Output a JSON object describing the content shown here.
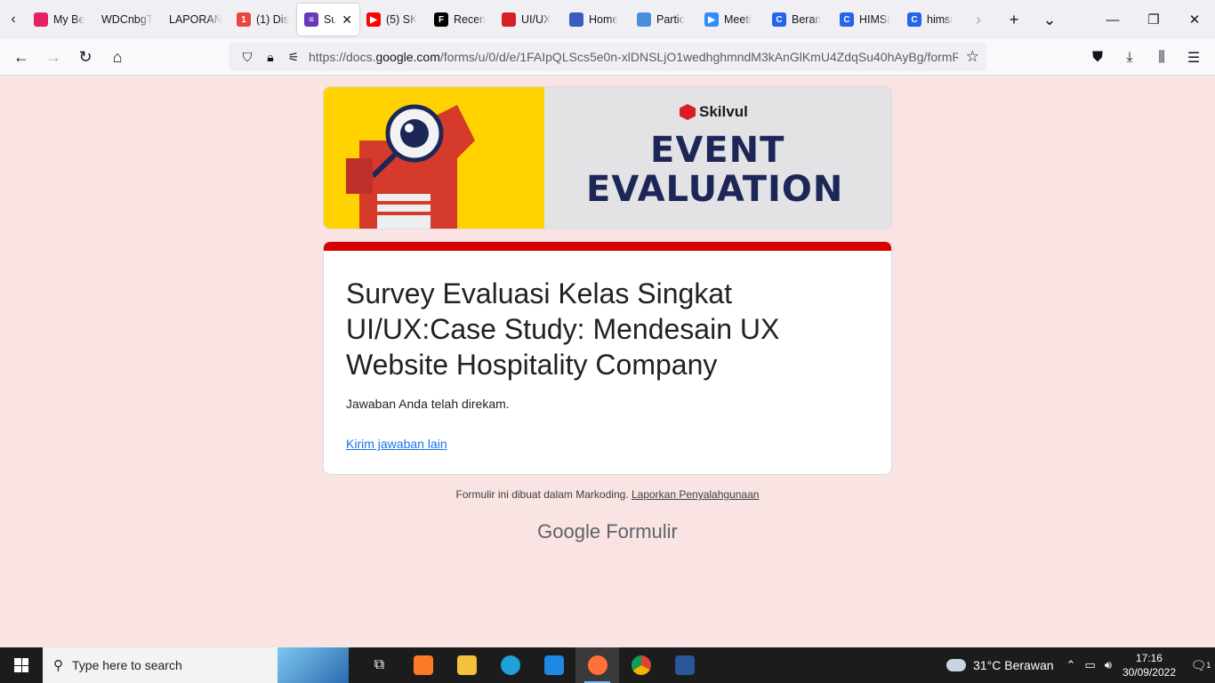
{
  "tabs": [
    {
      "label": "My Be",
      "color": "#e91e63",
      "glyph": ""
    },
    {
      "label": "WDCnbgT",
      "color": "",
      "glyph": ""
    },
    {
      "label": "LAPORAN",
      "color": "",
      "glyph": ""
    },
    {
      "label": "(1) Dis",
      "color": "#e8453c",
      "glyph": "1"
    },
    {
      "label": "Sur",
      "color": "#673ab7",
      "glyph": "≡",
      "active": true
    },
    {
      "label": "(5) SK",
      "color": "#ff0000",
      "glyph": "▶"
    },
    {
      "label": "Recen",
      "color": "#000000",
      "glyph": "F"
    },
    {
      "label": "UI/UX",
      "color": "#d91f26",
      "glyph": ""
    },
    {
      "label": "Home",
      "color": "#3a5bbf",
      "glyph": ""
    },
    {
      "label": "Partic",
      "color": "#4a90d9",
      "glyph": ""
    },
    {
      "label": "Meeti",
      "color": "#2d8cff",
      "glyph": "▶"
    },
    {
      "label": "Beran",
      "color": "#2563eb",
      "glyph": "C"
    },
    {
      "label": "HIMSI",
      "color": "#2563eb",
      "glyph": "C"
    },
    {
      "label": "himsi",
      "color": "#2563eb",
      "glyph": "C"
    }
  ],
  "url": {
    "prefix": "https://docs.",
    "domain": "google.com",
    "path": "/forms/u/0/d/e/1FAIpQLScs5e0n-xlDNSLjO1wedhghmndM3kAnGlKmU4ZdqSu40hAyBg/formR"
  },
  "banner": {
    "brand": "Skilvul",
    "line1": "EVENT",
    "line2": "EVALUATION"
  },
  "form": {
    "title": "Survey Evaluasi Kelas Singkat UI/UX:Case Study: Mendesain UX Website Hospitality Company",
    "confirmation": "Jawaban Anda telah direkam.",
    "submit_another": "Kirim jawaban lain",
    "accent": "#d70000"
  },
  "footer": {
    "note": "Formulir ini dibuat dalam Markoding.",
    "report": "Laporkan Penyalahgunaan",
    "logo_google": "Google",
    "logo_forms": "Formulir"
  },
  "taskbar": {
    "search_placeholder": "Type here to search",
    "weather": "31°C  Berawan",
    "time": "17:16",
    "date": "30/09/2022",
    "notifications": "1"
  }
}
